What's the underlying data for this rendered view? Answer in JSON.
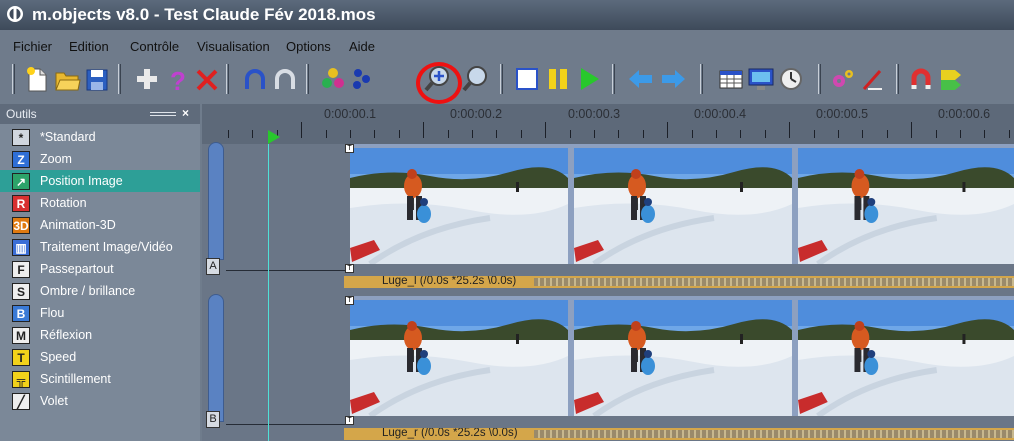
{
  "window": {
    "title": "m.objects v8.0 - Test Claude Fév 2018.mos"
  },
  "menu": [
    "Fichier",
    "Edition",
    "Contrôle",
    "Visualisation",
    "Options",
    "Aide"
  ],
  "toolbar": {
    "icons": [
      "new-file-icon",
      "open-folder-icon",
      "save-icon",
      "add-icon",
      "help-icon",
      "delete-icon",
      "undo-icon",
      "redo-icon",
      "color-dots-icon",
      "blue-dots-icon",
      "zoom-in-icon",
      "zoom-out-icon",
      "stop-icon",
      "pause-icon",
      "play-icon",
      "arrow-left-icon",
      "arrow-right-icon",
      "table-icon",
      "monitor-icon",
      "clock-icon",
      "gears-icon",
      "magic-wand-icon",
      "magnet-icon",
      "marker-icon"
    ],
    "highlighted": "zoom-in-icon",
    "highlight_color": "#ee1111"
  },
  "tools_panel": {
    "title": "Outils",
    "close": "×",
    "selected": "Position Image",
    "items": [
      {
        "icon": "*",
        "label": "*Standard",
        "color": "#d0d6de"
      },
      {
        "icon": "Z",
        "label": "Zoom",
        "color": "#2f6fd6"
      },
      {
        "icon": "↗",
        "label": "Position Image",
        "color": "#2ca36a"
      },
      {
        "icon": "R",
        "label": "Rotation",
        "color": "#d83030"
      },
      {
        "icon": "3D",
        "label": "Animation-3D",
        "color": "#e07a10"
      },
      {
        "icon": "▥",
        "label": "Traitement Image/Vidéo",
        "color": "#3b6ed6"
      },
      {
        "icon": "F",
        "label": "Passepartout",
        "color": "#eeeeee"
      },
      {
        "icon": "S",
        "label": "Ombre / brillance",
        "color": "#eeeeee"
      },
      {
        "icon": "B",
        "label": "Flou",
        "color": "#3a7ad6"
      },
      {
        "icon": "M",
        "label": "Réflexion",
        "color": "#eeeeee"
      },
      {
        "icon": "T",
        "label": "Speed",
        "color": "#f2d21a"
      },
      {
        "icon": "╦",
        "label": "Scintillement",
        "color": "#f2d21a"
      },
      {
        "icon": "╱",
        "label": "Volet",
        "color": "#eeeeee"
      }
    ]
  },
  "timeline": {
    "ruler_labels": [
      "0:00:00.1",
      "0:00:00.2",
      "0:00:00.3",
      "0:00:00.4",
      "0:00:00.5",
      "0:00:00.6"
    ],
    "tracks": [
      {
        "label": "A",
        "clip": "Luge_l (/0.0s *25.2s \\0.0s)"
      },
      {
        "label": "B",
        "clip": "Luge_r (/0.0s *25.2s \\0.0s)"
      }
    ],
    "playhead_color": "#28c82c",
    "clip_bar_color": "#d4a64a"
  }
}
